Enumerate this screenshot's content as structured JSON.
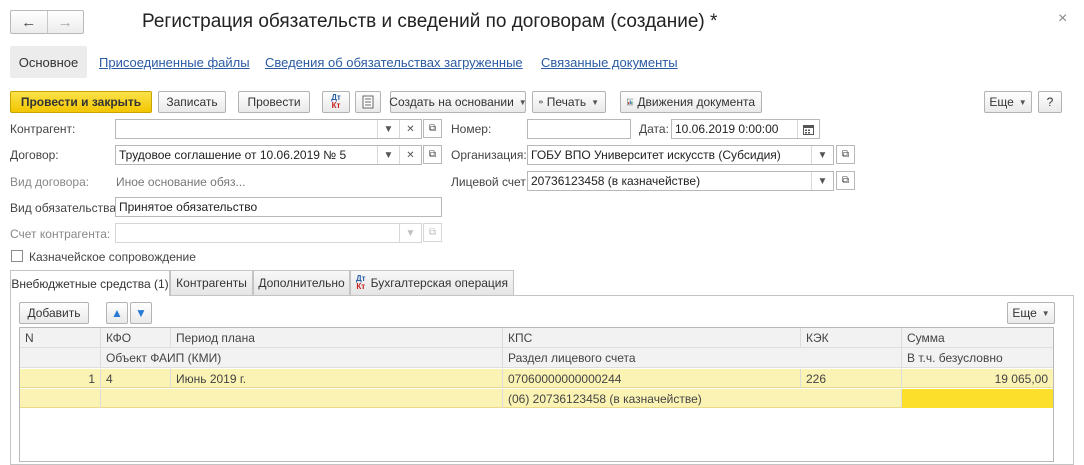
{
  "window": {
    "title": "Регистрация обязательств и сведений по договорам (создание) *",
    "back_glyph": "←",
    "forward_glyph": "→",
    "close_glyph": "×"
  },
  "links": {
    "main": "Основное",
    "files": "Присоединенные файлы",
    "loaded": "Сведения об обязательствах загруженные",
    "related": "Связанные документы"
  },
  "toolbar": {
    "post_close": "Провести и закрыть",
    "save": "Записать",
    "post": "Провести",
    "create_based": "Создать на основании",
    "print": "Печать",
    "movements": "Движения документа",
    "more": "Еще",
    "help": "?"
  },
  "form": {
    "counterparty_label": "Контрагент:",
    "counterparty_value": "",
    "contract_label": "Договор:",
    "contract_value": "Трудовое соглашение от 10.06.2019 № 5",
    "contract_type_label": "Вид договора:",
    "contract_type_value": "Иное основание обяз...",
    "obligation_type_label": "Вид обязательства:",
    "obligation_type_value": "Принятое обязательство",
    "counterparty_account_label": "Счет контрагента:",
    "counterparty_account_value": "",
    "treasury_label": "Казначейское сопровождение",
    "number_label": "Номер:",
    "number_value": "",
    "date_label": "Дата:",
    "date_value": "10.06.2019  0:00:00",
    "organization_label": "Организация:",
    "organization_value": "ГОБУ ВПО Университет искусств (Субсидия)",
    "account_label": "Лицевой счет:",
    "account_value": "20736123458 (в казначействе)"
  },
  "tabs": [
    {
      "label": "Внебюджетные средства (1)"
    },
    {
      "label": "Контрагенты"
    },
    {
      "label": "Дополнительно"
    },
    {
      "label": "Бухгалтерская операция"
    }
  ],
  "icons": {
    "dt": "Дт",
    "kt": "Кт"
  },
  "table_toolbar": {
    "add": "Добавить",
    "more": "Еще"
  },
  "table": {
    "headers_row1": [
      "N",
      "КФО",
      "Период плана",
      "КПС",
      "КЭК",
      "Сумма"
    ],
    "headers_row2": [
      "",
      "",
      "Объект ФАИП (КМИ)",
      "Раздел лицевого счета",
      "",
      "В т.ч. безусловно"
    ],
    "rows": [
      {
        "n": "1",
        "kfo": "4",
        "period": "Июнь 2019 г.",
        "kps": "07060000000000244",
        "kek": "226",
        "sum": "19 065,00",
        "object": "",
        "section": "(06) 20736123458 (в казначействе)",
        "unconditional": ""
      }
    ]
  },
  "colors": {
    "primary_button": "#f2c500",
    "link": "#2a5ba3",
    "row_highlight": "#fbf3b4",
    "cell_highlight": "#fbdf2a"
  }
}
